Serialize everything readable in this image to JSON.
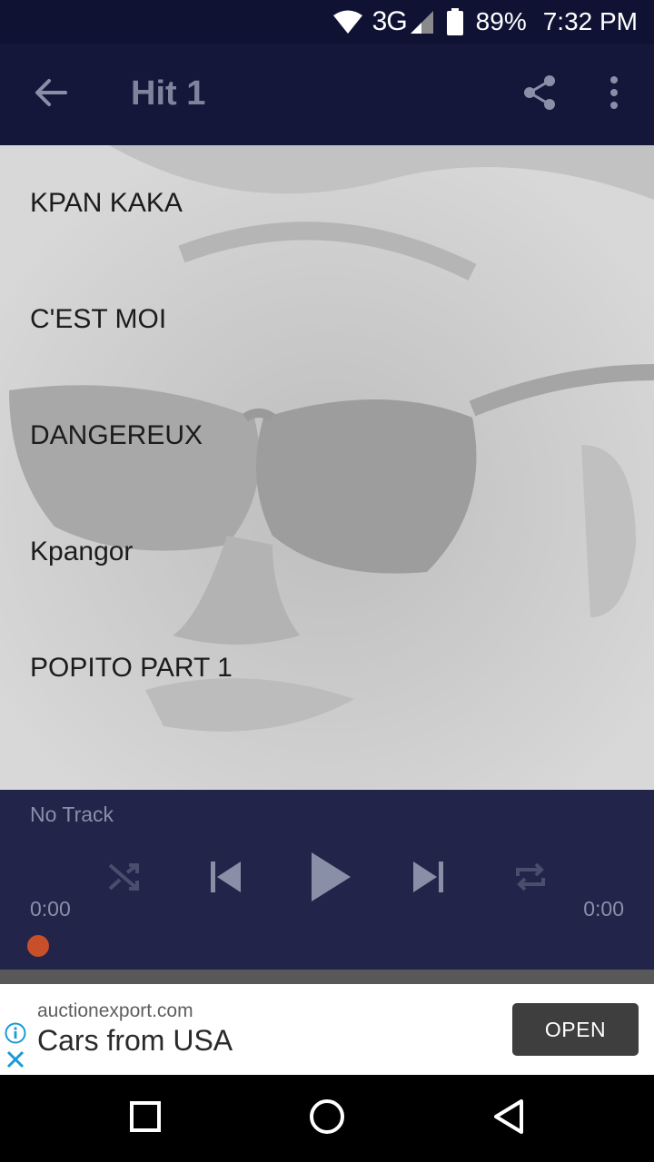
{
  "status_bar": {
    "network": "3G",
    "battery": "89%",
    "time": "7:32 PM",
    "icons": [
      "wifi-icon",
      "cell-signal-icon",
      "battery-icon"
    ]
  },
  "app_bar": {
    "title": "Hit 1",
    "icons": [
      "back-arrow-icon",
      "share-icon",
      "more-vert-icon"
    ]
  },
  "tracks": [
    {
      "title": "KPAN KAKA"
    },
    {
      "title": "C'EST MOI"
    },
    {
      "title": "DANGEREUX"
    },
    {
      "title": "Kpangor"
    },
    {
      "title": "POPITO PART 1"
    }
  ],
  "player": {
    "now_playing": "No Track",
    "elapsed": "0:00",
    "duration": "0:00",
    "progress": 0,
    "controls": [
      "shuffle-icon",
      "previous-icon",
      "play-icon",
      "next-icon",
      "repeat-icon"
    ]
  },
  "ad": {
    "domain": "auctionexport.com",
    "headline": "Cars from USA",
    "cta": "OPEN",
    "icons": [
      "info-icon",
      "close-icon"
    ]
  },
  "nav_bar": {
    "icons": [
      "recents-icon",
      "home-icon",
      "back-icon"
    ]
  },
  "colors": {
    "status_bar_bg": "#0f1233",
    "app_bar_bg": "#15173a",
    "player_bg": "#22244a",
    "seek_thumb": "#c7502a",
    "ad_button_bg": "#3e3e3e"
  }
}
